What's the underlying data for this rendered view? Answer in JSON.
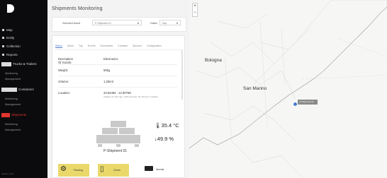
{
  "app": {
    "title": "Shipments Monitoring",
    "version": "version 1.0.0"
  },
  "sidebar": {
    "items": [
      {
        "label": "Map"
      },
      {
        "label": "Entity"
      },
      {
        "label": "Collection"
      },
      {
        "label": "Reports"
      }
    ],
    "sections": [
      {
        "label": "Trucks & Trailers",
        "subs": [
          "Monitoring",
          "Management"
        ]
      },
      {
        "label": "Containers",
        "subs": [
          "Monitoring",
          "Management"
        ]
      },
      {
        "label": "Shipments",
        "subs": [
          "Monitoring",
          "Management"
        ]
      }
    ]
  },
  "filters": {
    "selected_label": "Selected Asset",
    "selected_value": "P-Shipment 01",
    "dates_label": "Dates",
    "dates_value": "Day"
  },
  "tabs": [
    "Status",
    "Alerts",
    "Trip",
    "Events",
    "Documents",
    "Contacts",
    "Sensors",
    "Configuration"
  ],
  "details": {
    "description_label": "Description Of Goods:",
    "description_value": "Electronics",
    "weight_label": "Weight:",
    "weight_value": "50kg",
    "volume_label": "Volume:",
    "volume_value": "1.25m3",
    "location_label": "Location:",
    "location_value": "43.52484 - 12.90768",
    "location_detail": "Updated: 1h 20m ago - GPS Accuracy: 5m (M.A.R.S. location)"
  },
  "sensors": {
    "temperature": "35.4 °C",
    "humidity": "49.9 %",
    "name": "P-Shipment 01"
  },
  "status": {
    "pending": "Pending",
    "check": "Check",
    "normal": "Normal"
  },
  "map": {
    "zoom_in": "+",
    "zoom_out": "−",
    "labels": {
      "bologna": "Bologna",
      "san_marino": "San Marino",
      "marker": "P-Shipment 01"
    }
  }
}
